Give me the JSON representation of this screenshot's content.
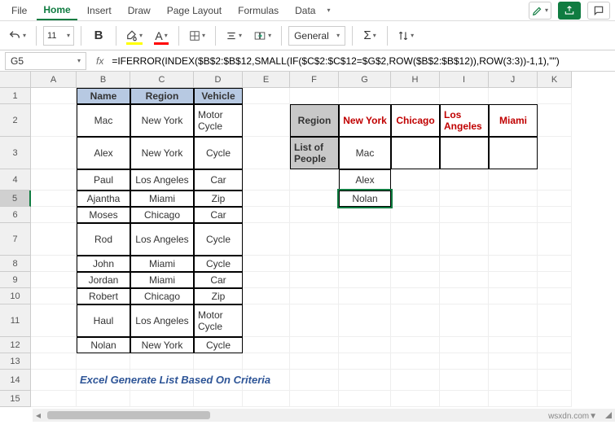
{
  "tabs": [
    "File",
    "Home",
    "Insert",
    "Draw",
    "Page Layout",
    "Formulas",
    "Data"
  ],
  "active_tab": "Home",
  "toolbar": {
    "font_size": "11",
    "number_format": "General"
  },
  "name_box": "G5",
  "fx": "fx",
  "formula": "=IFERROR(INDEX($B$2:$B$12,SMALL(IF($C$2:$C$12=$G$2,ROW($B$2:$B$12)),ROW(3:3))-1,1),\"\")",
  "col_letters": [
    "A",
    "B",
    "C",
    "D",
    "E",
    "F",
    "G",
    "H",
    "I",
    "J",
    "K"
  ],
  "row_nums": [
    "1",
    "2",
    "3",
    "4",
    "5",
    "6",
    "7",
    "8",
    "9",
    "10",
    "11",
    "12",
    "13",
    "14",
    "15"
  ],
  "selected_row": 5,
  "table1": {
    "headers": [
      "Name",
      "Region",
      "Vehicle"
    ],
    "rows": [
      [
        "Mac",
        "New York",
        "Motor Cycle"
      ],
      [
        "Alex",
        "New York",
        "Cycle"
      ],
      [
        "Paul",
        "Los Angeles",
        "Car"
      ],
      [
        "Ajantha",
        "Miami",
        "Zip"
      ],
      [
        "Moses",
        "Chicago",
        "Car"
      ],
      [
        "Rod",
        "Los Angeles",
        "Cycle"
      ],
      [
        "John",
        "Miami",
        "Cycle"
      ],
      [
        "Jordan",
        "Miami",
        "Car"
      ],
      [
        "Robert",
        "Chicago",
        "Zip"
      ],
      [
        "Haul",
        "Los Angeles",
        "Motor Cycle"
      ],
      [
        "Nolan",
        "New York",
        "Cycle"
      ]
    ]
  },
  "table2": {
    "row_labels": [
      "Region",
      "List of People"
    ],
    "regions": [
      "New York",
      "Chicago",
      "Los Angeles",
      "Miami"
    ],
    "people_newyork": [
      "Mac",
      "Alex",
      "Nolan"
    ]
  },
  "caption": "Excel Generate List Based On Criteria",
  "footer": "wsxdn.com▼"
}
